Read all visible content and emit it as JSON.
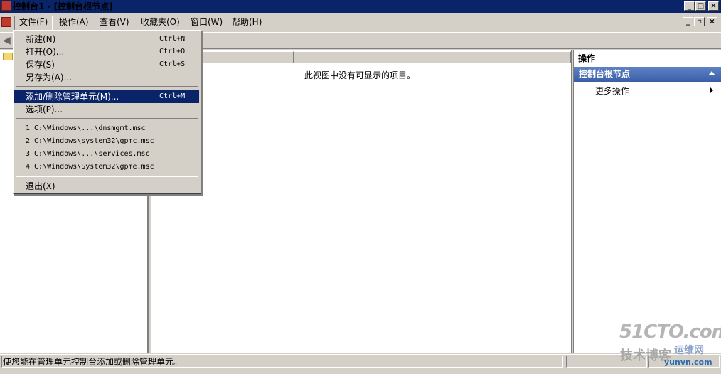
{
  "window": {
    "title": "控制台1 - [控制台根节点]",
    "controls": {
      "minimize": "_",
      "maximize": "□",
      "close": "×"
    },
    "mdi_controls": {
      "minimize": "_",
      "restore": "▫",
      "close": "×"
    }
  },
  "menu": {
    "items": [
      "文件(F)",
      "操作(A)",
      "查看(V)",
      "收藏夹(O)",
      "窗口(W)",
      "帮助(H)"
    ],
    "active_index": 0
  },
  "file_menu": {
    "items": [
      {
        "label": "新建(N)",
        "shortcut": "Ctrl+N"
      },
      {
        "label": "打开(O)...",
        "shortcut": "Ctrl+O"
      },
      {
        "label": "保存(S)",
        "shortcut": "Ctrl+S"
      },
      {
        "label": "另存为(A)...",
        "shortcut": ""
      },
      {
        "label": "添加/删除管理单元(M)...",
        "shortcut": "Ctrl+M",
        "highlighted": true
      },
      {
        "label": "选项(P)...",
        "shortcut": ""
      },
      {
        "label": "1 C:\\Windows\\...\\dnsmgmt.msc"
      },
      {
        "label": "2 C:\\Windows\\system32\\gpmc.msc"
      },
      {
        "label": "3 C:\\Windows\\...\\services.msc"
      },
      {
        "label": "4 C:\\Windows\\System32\\gpme.msc"
      },
      {
        "label": "退出(X)"
      }
    ]
  },
  "center": {
    "empty_message": "此视图中没有可显示的项目。"
  },
  "actions_pane": {
    "title": "操作",
    "group_title": "控制台根节点",
    "items": [
      "更多操作"
    ]
  },
  "status_bar": {
    "text": "使您能在管理单元控制台添加或删除管理单元。"
  },
  "watermark": {
    "line1": "51CTO.com",
    "line2": "技术博客",
    "line3": "运维网",
    "line4": "yunvn.com"
  },
  "colors": {
    "title_bar": "#0a246a",
    "highlight": "#0a246a",
    "action_header": "#3a5fa8"
  }
}
